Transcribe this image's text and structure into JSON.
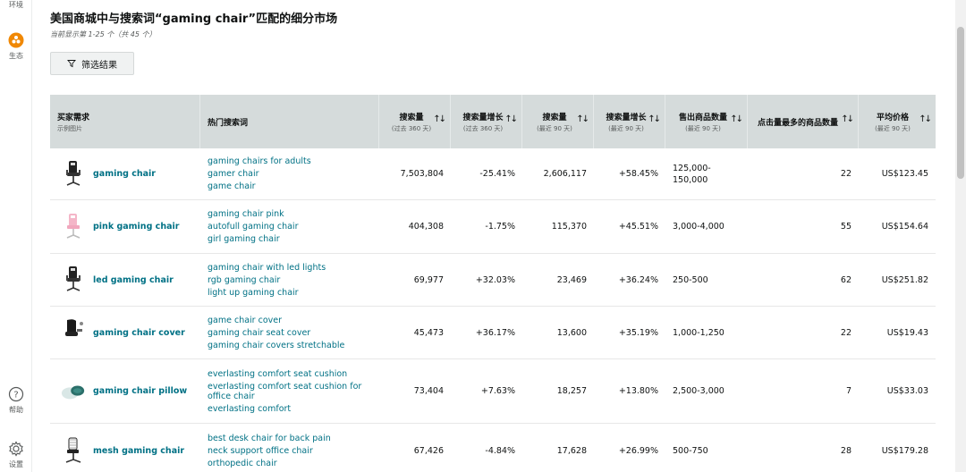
{
  "rail": {
    "top_label": "环境",
    "eco_label": "生态",
    "help_label": "帮助",
    "settings_label": "设置"
  },
  "page": {
    "title": "美国商城中与搜索词“gaming chair”匹配的细分市场",
    "subtitle": "当前显示第 1-25 个（共 45 个）",
    "filter_label": "筛选结果"
  },
  "columns": [
    {
      "label": "买家需求",
      "sub": "示例图片"
    },
    {
      "label": "热门搜索词",
      "sub": ""
    },
    {
      "label": "搜索量",
      "sub": "(过去 360 天)"
    },
    {
      "label": "搜索量增长",
      "sub": "(过去 360 天)"
    },
    {
      "label": "搜索量",
      "sub": "(最近 90 天)"
    },
    {
      "label": "搜索量增长",
      "sub": "(最近 90 天)"
    },
    {
      "label": "售出商品数量",
      "sub": "(最近 90 天)"
    },
    {
      "label": "点击量最多的商品数量",
      "sub": ""
    },
    {
      "label": "平均价格",
      "sub": "(最近 90 天)"
    }
  ],
  "rows": [
    {
      "name": "gaming chair",
      "terms": [
        "gaming chairs for adults",
        "gamer chair",
        "game chair"
      ],
      "sv360": "7,503,804",
      "g360": "-25.41%",
      "sv90": "2,606,117",
      "g90": "+58.45%",
      "sold": "125,000-150,000",
      "clicked": "22",
      "price": "US$123.45",
      "thumb": "black"
    },
    {
      "name": "pink gaming chair",
      "terms": [
        "gaming chair pink",
        "autofull gaming chair",
        "girl gaming chair"
      ],
      "sv360": "404,308",
      "g360": "-1.75%",
      "sv90": "115,370",
      "g90": "+45.51%",
      "sold": "3,000-4,000",
      "clicked": "55",
      "price": "US$154.64",
      "thumb": "pink"
    },
    {
      "name": "led gaming chair",
      "terms": [
        "gaming chair with led lights",
        "rgb gaming chair",
        "light up gaming chair"
      ],
      "sv360": "69,977",
      "g360": "+32.03%",
      "sv90": "23,469",
      "g90": "+36.24%",
      "sold": "250-500",
      "clicked": "62",
      "price": "US$251.82",
      "thumb": "black"
    },
    {
      "name": "gaming chair cover",
      "terms": [
        "game chair cover",
        "gaming chair seat cover",
        "gaming chair covers stretchable"
      ],
      "sv360": "45,473",
      "g360": "+36.17%",
      "sv90": "13,600",
      "g90": "+35.19%",
      "sold": "1,000-1,250",
      "clicked": "22",
      "price": "US$19.43",
      "thumb": "cover"
    },
    {
      "name": "gaming chair pillow",
      "terms": [
        "everlasting comfort seat cushion",
        "everlasting comfort seat cushion for office chair",
        "everlasting comfort"
      ],
      "sv360": "73,404",
      "g360": "+7.63%",
      "sv90": "18,257",
      "g90": "+13.80%",
      "sold": "2,500-3,000",
      "clicked": "7",
      "price": "US$33.03",
      "thumb": "pillow"
    },
    {
      "name": "mesh gaming chair",
      "terms": [
        "best desk chair for back pain",
        "neck support office chair",
        "orthopedic chair"
      ],
      "sv360": "67,426",
      "g360": "-4.84%",
      "sv90": "17,628",
      "g90": "+26.99%",
      "sold": "500-750",
      "clicked": "28",
      "price": "US$179.28",
      "thumb": "mesh"
    }
  ]
}
